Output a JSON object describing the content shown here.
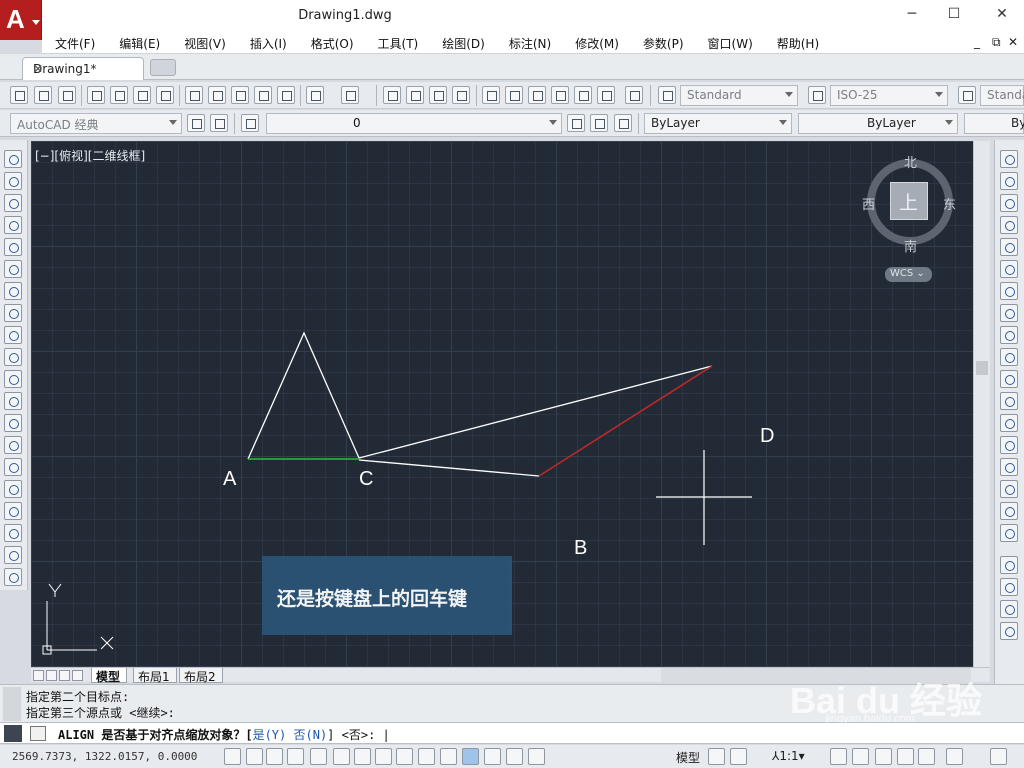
{
  "window": {
    "title": "Drawing1.dwg",
    "minimize": "─",
    "maximize": "☐",
    "close": "✕",
    "app_letter": "A"
  },
  "menu": [
    "文件(F)",
    "编辑(E)",
    "视图(V)",
    "插入(I)",
    "格式(O)",
    "工具(T)",
    "绘图(D)",
    "标注(N)",
    "修改(M)",
    "参数(P)",
    "窗口(W)",
    "帮助(H)"
  ],
  "menu_right": [
    "_",
    "⧉",
    "✕"
  ],
  "tabs": {
    "active": "Drawing1*",
    "close": "✕"
  },
  "toolbar1": {
    "text_style": "Standard",
    "dim_style": "ISO-25",
    "table_style": "Standa"
  },
  "toolbar2": {
    "workspace": "AutoCAD 经典",
    "layer": "0",
    "color": "ByLayer",
    "linetype": "ByLayer",
    "lineweight": "By"
  },
  "viewport_label": "[−][俯视][二维线框]",
  "viewcube": {
    "north": "北",
    "south": "南",
    "east": "东",
    "west": "西",
    "face": "上",
    "wcs": "WCS ⌄"
  },
  "points": {
    "a": "A",
    "b": "B",
    "c": "C",
    "d": "D"
  },
  "caption": "还是按键盘上的回车键",
  "ucs": {
    "x": "X",
    "y": "Y"
  },
  "layout_tabs": [
    "模型",
    "布局1",
    "布局2"
  ],
  "command_history": [
    "指定第二个目标点:",
    "指定第三个源点或 <继续>:"
  ],
  "command_prompt": {
    "pre": "ALIGN 是否基于对齐点缩放对象？[",
    "opt_yes": "是(Y)",
    "mid": " 否(N)",
    "post": "] <否>: |"
  },
  "status": {
    "coords": "2569.7373, 1322.0157, 0.0000",
    "model": "模型",
    "scale": "⅄1:1▾"
  },
  "watermark": {
    "brand": "Bai du 经验",
    "url": "jingyan.baidu.com"
  },
  "colors": {
    "canvas": "#222a36",
    "red_line": "#c0282a",
    "green_line": "#2fbd3a",
    "white_line": "#ffffff"
  }
}
